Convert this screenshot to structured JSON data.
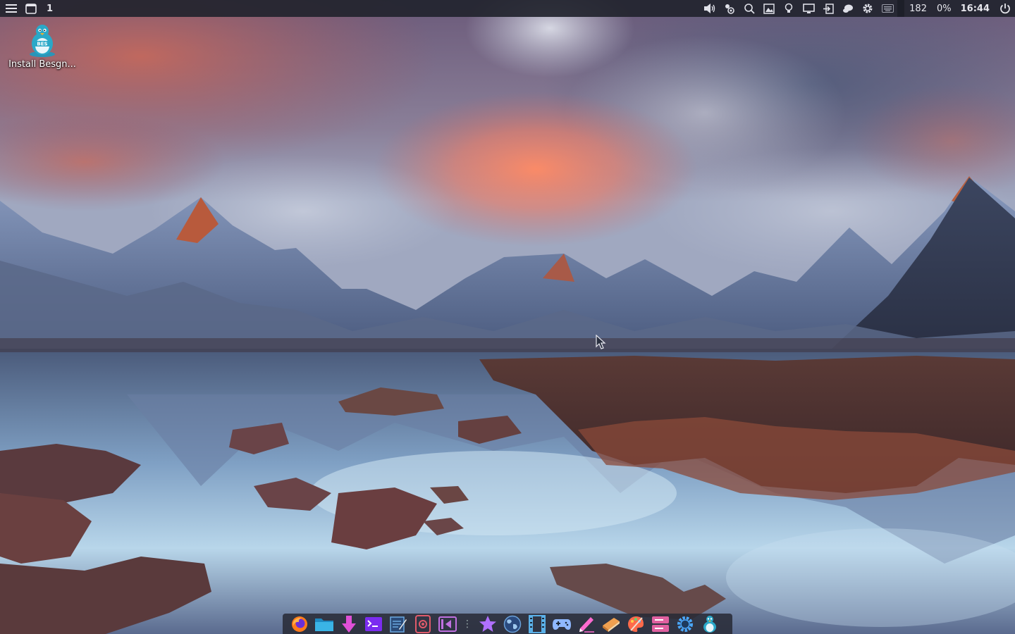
{
  "top_panel": {
    "menu_icon": "hamburger-menu-icon",
    "window_list_icon": "window-icon",
    "workspace_number": "1",
    "tray_icons": [
      "volume-icon",
      "weather-icon",
      "search-icon",
      "image-viewer-icon",
      "lightbulb-icon",
      "display-icon",
      "logout-icon",
      "chat-icon",
      "settings-icon",
      "keyboard-icon"
    ],
    "counter": "182",
    "cpu_percent": "0%",
    "clock": "16:44",
    "power_icon": "power-icon"
  },
  "desktop": {
    "icons": [
      {
        "label": "Install Besgn...",
        "icon": "tux-installer-icon"
      }
    ]
  },
  "dock": {
    "items": [
      {
        "icon": "firefox-icon",
        "color": "#ff7a1a"
      },
      {
        "icon": "folder-icon",
        "color": "#29a3d6"
      },
      {
        "icon": "download-icon",
        "color": "#e050d8"
      },
      {
        "icon": "terminal-icon",
        "color": "#7b2cf0"
      },
      {
        "icon": "text-editor-icon",
        "color": "#6aa8e0"
      },
      {
        "icon": "screen-recorder-icon",
        "color": "#e05a6a"
      },
      {
        "icon": "media-player-icon",
        "color": "#c070e0"
      },
      {
        "icon": "favorites-star-icon",
        "color": "#b070ff"
      },
      {
        "icon": "globe-icon",
        "color": "#6aa0d8"
      },
      {
        "icon": "video-editor-icon",
        "color": "#5ab0e8"
      },
      {
        "icon": "gamepad-icon",
        "color": "#8fb8ff"
      },
      {
        "icon": "drawing-pen-icon",
        "color": "#ff6bd0"
      },
      {
        "icon": "ebook-icon",
        "color": "#f0a050"
      },
      {
        "icon": "paint-palette-icon",
        "color": "#ff6a4a"
      },
      {
        "icon": "storage-icon",
        "color": "#e060a0"
      },
      {
        "icon": "system-settings-icon",
        "color": "#4aa8ff"
      },
      {
        "icon": "tux-installer-icon",
        "color": "#2aa8c8"
      }
    ]
  }
}
